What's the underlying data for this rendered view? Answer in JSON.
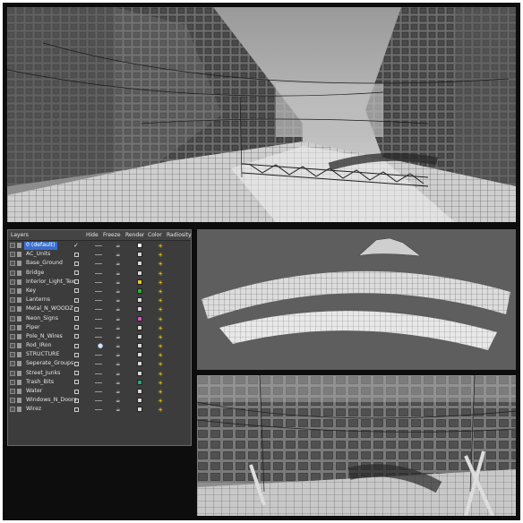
{
  "layer_panel": {
    "columns": [
      "Layers",
      "Hide",
      "Freeze",
      "Render",
      "Color",
      "Radiosity"
    ],
    "rows": [
      {
        "name": "0 (default)",
        "selected": true,
        "hidden": true,
        "color": "#ffffff"
      },
      {
        "name": "AC_Units",
        "color": "#d8d8d8"
      },
      {
        "name": "Base_Ground",
        "color": "#d8d8d8"
      },
      {
        "name": "Bridge",
        "color": "#d8d8d8"
      },
      {
        "name": "Interior_Light_Tex",
        "color": "#e7c23c"
      },
      {
        "name": "Key",
        "color": "#2fa83a"
      },
      {
        "name": "Lanterns",
        "color": "#d8d8d8"
      },
      {
        "name": "Metal_N_WOODZ",
        "color": "#d8d8d8"
      },
      {
        "name": "Neon_Signs",
        "color": "#d84fc6"
      },
      {
        "name": "Piper",
        "color": "#d8d8d8"
      },
      {
        "name": "Pole_N_Wires",
        "color": "#d8d8d8"
      },
      {
        "name": "Rod_IRon",
        "color": "#d8d8d8",
        "frozen_bulb": true
      },
      {
        "name": "STRUCTURE",
        "color": "#d8d8d8"
      },
      {
        "name": "Seperate_Groups",
        "color": "#d8d8d8"
      },
      {
        "name": "Street_Junks",
        "color": "#d8d8d8"
      },
      {
        "name": "Trash_Bits",
        "color": "#2fa07a"
      },
      {
        "name": "Water",
        "color": "#d8d8d8"
      },
      {
        "name": "Windows_N_Doors",
        "color": "#d8d8d8"
      },
      {
        "name": "Wirez",
        "color": "#d8d8d8"
      }
    ]
  },
  "icons": {
    "render": "teapot-icon",
    "radiosity": "sun-icon",
    "layer": "layer-icon"
  },
  "colors": {
    "frame": "#0d0d0d",
    "panel_bg": "#3c3c3c",
    "selection": "#3b6fd0",
    "viewport_bg": "#5e5e5e"
  }
}
